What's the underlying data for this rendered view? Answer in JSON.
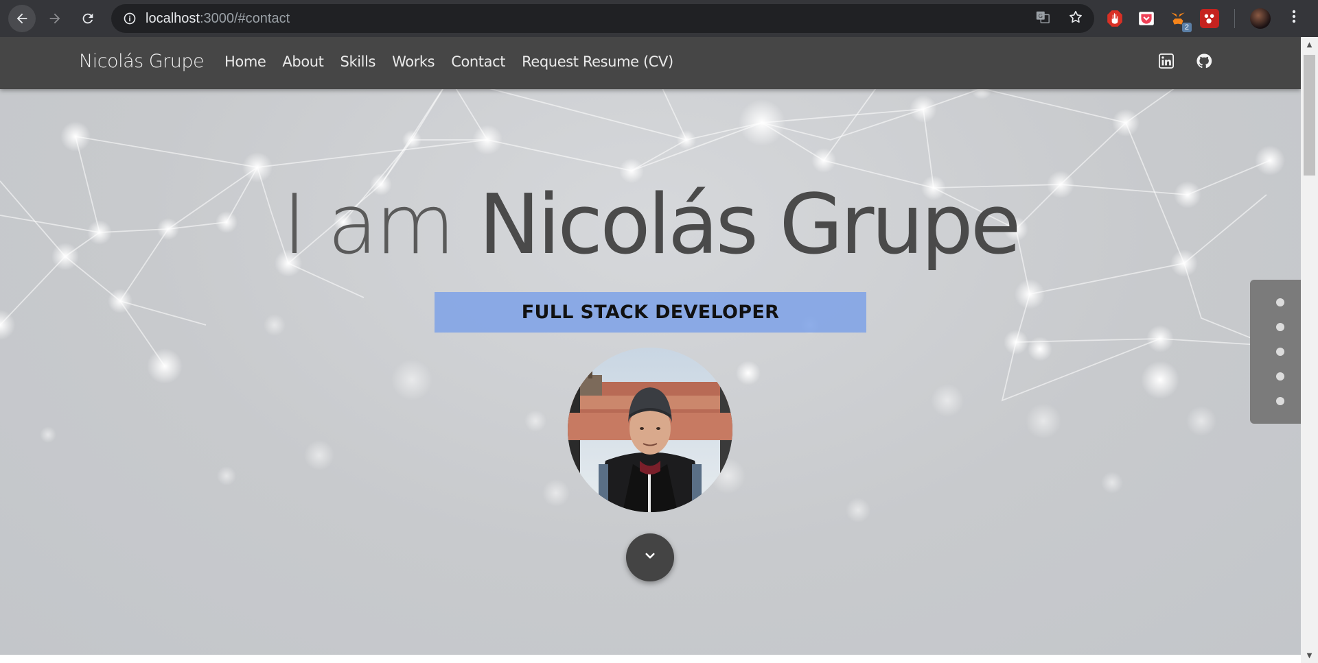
{
  "browser": {
    "url_host": "localhost",
    "url_rest": ":3000/#contact",
    "icons": [
      "back-arrow-icon",
      "forward-arrow-icon",
      "reload-icon",
      "site-info-icon",
      "translate-icon",
      "bookmark-star-icon",
      "menu-kebab-icon"
    ],
    "extensions": [
      {
        "name": "adblock-extension-icon",
        "color": "#d93025"
      },
      {
        "name": "pocket-extension-icon",
        "color": "#ef4056"
      },
      {
        "name": "metamask-extension-icon",
        "color": "#f6851b",
        "badge": "2"
      },
      {
        "name": "puzzle-extension-icon",
        "color": "#c5221f"
      }
    ]
  },
  "nav": {
    "brand": "Nicolás Grupe",
    "links": [
      "Home",
      "About",
      "Skills",
      "Works",
      "Contact",
      "Request Resume (CV)"
    ],
    "social": [
      "linkedin-icon",
      "github-icon"
    ]
  },
  "hero": {
    "title_prefix": "I am",
    "title_name": "Nicolás Grupe",
    "role": "FULL STACK DEVELOPER",
    "accent_color": "#7aa0e8"
  },
  "section_dots": {
    "count": 5
  },
  "colors": {
    "navbar": "#464646",
    "browser_chrome": "#35363a",
    "hero_text": "#4a4a4a"
  }
}
